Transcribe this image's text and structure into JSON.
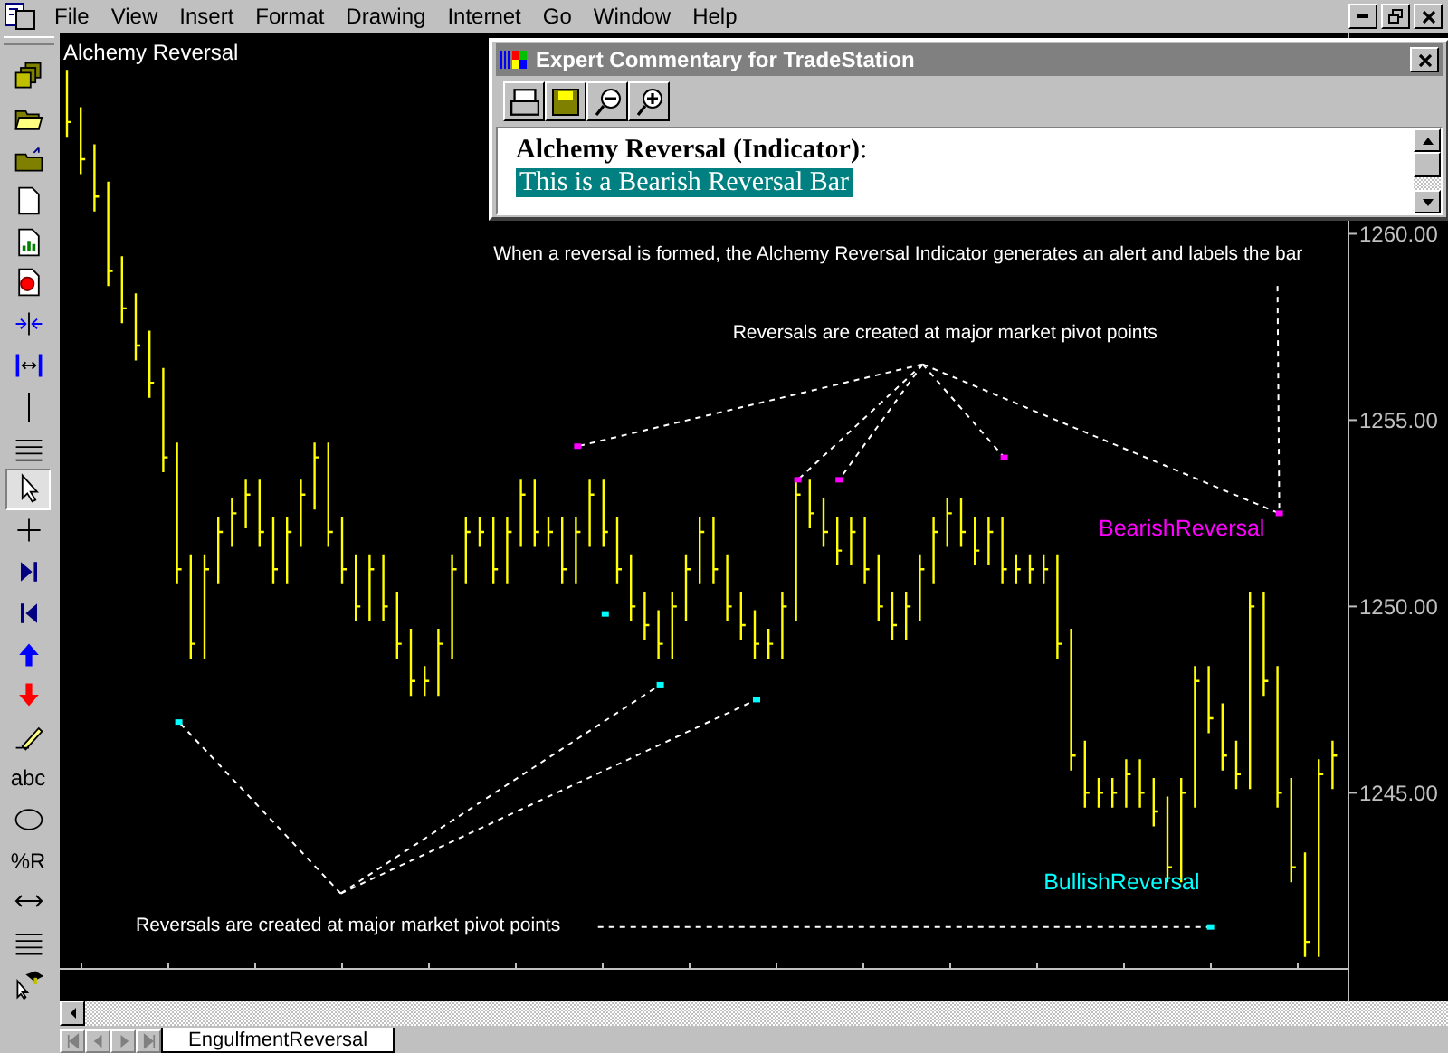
{
  "menu_bar": {
    "items": [
      "File",
      "View",
      "Insert",
      "Format",
      "Drawing",
      "Internet",
      "Go",
      "Window",
      "Help"
    ]
  },
  "toolbar": {
    "items": [
      {
        "kind": "window-stack",
        "selected": false
      },
      {
        "kind": "open-folder",
        "selected": false
      },
      {
        "kind": "folder",
        "selected": false
      },
      {
        "kind": "new-document",
        "selected": false
      },
      {
        "kind": "chart-document",
        "selected": false
      },
      {
        "kind": "target-document",
        "selected": false
      },
      {
        "kind": "compress",
        "selected": false
      },
      {
        "kind": "expand",
        "selected": false
      },
      {
        "kind": "vertical-line",
        "selected": false
      },
      {
        "kind": "lines",
        "selected": false
      },
      {
        "kind": "pointer",
        "selected": true
      },
      {
        "kind": "crosshair",
        "selected": false
      },
      {
        "kind": "next-bar",
        "selected": false
      },
      {
        "kind": "first-bar",
        "selected": false
      },
      {
        "kind": "up-arrow",
        "selected": false
      },
      {
        "kind": "down-arrow",
        "selected": false
      },
      {
        "kind": "pencil",
        "selected": false
      },
      {
        "kind": "text",
        "label": "abc",
        "selected": false
      },
      {
        "kind": "ellipse",
        "selected": false
      },
      {
        "kind": "text",
        "label": "%R",
        "selected": false
      },
      {
        "kind": "double-arrow",
        "selected": false
      },
      {
        "kind": "lines",
        "selected": false
      },
      {
        "kind": "cap-pointer",
        "selected": false
      }
    ]
  },
  "chart": {
    "title": "Alchemy Reversal",
    "price_labels": [
      "1260.00",
      "1255.00",
      "1250.00",
      "1245.00"
    ],
    "notes": [
      "When a reversal is formed, the Alchemy Reversal Indicator generates an alert and labels the bar",
      "Reversals are created at major market pivot points",
      "Reversals are created at major market pivot points"
    ],
    "reversal_labels": [
      {
        "text": "BearishReversal",
        "color": "#ff00ff"
      },
      {
        "text": "BullishReversal",
        "color": "#00ffff"
      }
    ],
    "markers": [
      {
        "color": "#ff00ff"
      },
      {
        "color": "#ff00ff"
      },
      {
        "color": "#ff00ff"
      },
      {
        "color": "#ff00ff"
      },
      {
        "color": "#ff00ff"
      },
      {
        "color": "#00ffff"
      },
      {
        "color": "#00ffff"
      },
      {
        "color": "#00ffff"
      },
      {
        "color": "#00ffff"
      },
      {
        "color": "#00ffff"
      }
    ]
  },
  "commentary": {
    "title": "Expert Commentary for TradeStation",
    "heading": "**Alchemy Reversal (Indicator)**:",
    "line": "This is a Bearish Reversal Bar",
    "line_highlighted": true
  },
  "sheet_tabs": [
    {
      "label": "EngulfmentReversal",
      "selected": true
    }
  ]
}
